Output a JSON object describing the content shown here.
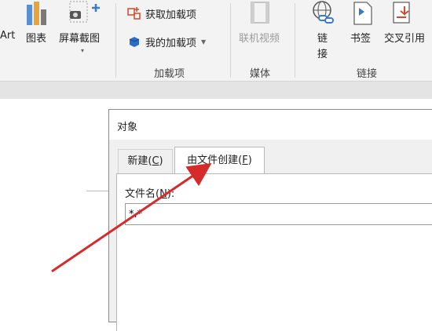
{
  "ribbon": {
    "smartart_partial": "Art",
    "chart_label": "图表",
    "screenshot_label": "屏幕截图",
    "get_addins_label": "获取加载项",
    "my_addins_label": "我的加载项",
    "addins_group": "加载项",
    "online_video_label": "联机视频",
    "media_group": "媒体",
    "link_label": "链",
    "link_label2": "接",
    "bookmark_label": "书签",
    "cross_ref_label": "交叉引用",
    "links_group": "链接"
  },
  "dialog": {
    "title": "对象",
    "tabs": [
      {
        "label": "新建(",
        "key": "C",
        "suffix": ")"
      },
      {
        "label": "由文件创建(",
        "key": "F",
        "suffix": ")"
      }
    ],
    "filename_label": "文件名(",
    "filename_key": "N",
    "filename_suffix": "):",
    "filename_value": "*.*"
  },
  "colors": {
    "ribbon_bg": "#f3f3f3",
    "arrow": "#d62b2b",
    "dialog_bg": "#ffffff"
  },
  "icons": [
    "chart-icon",
    "screenshot-icon",
    "store-icon",
    "my-addins-icon",
    "online-video-icon",
    "link-icon",
    "bookmark-icon",
    "cross-reference-icon"
  ]
}
